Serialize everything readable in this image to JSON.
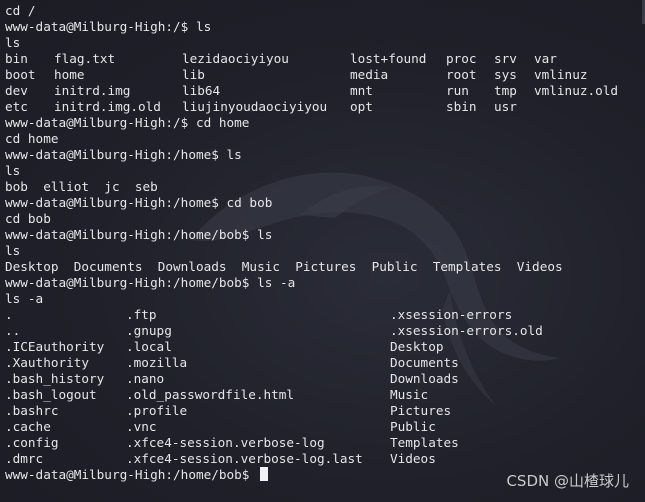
{
  "colors": {
    "background": "#1e1f29",
    "text": "#e6e6e6"
  },
  "lines": [
    "cd /",
    "www-data@Milburg-High:/$ ls",
    "ls"
  ],
  "root_listing": [
    [
      "bin",
      "flag.txt",
      "lezidaociyiyou",
      "lost+found",
      "proc",
      "srv",
      "var"
    ],
    [
      "boot",
      "home",
      "lib",
      "media",
      "root",
      "sys",
      "vmlinuz"
    ],
    [
      "dev",
      "initrd.img",
      "lib64",
      "mnt",
      "run",
      "tmp",
      "vmlinuz.old"
    ],
    [
      "etc",
      "initrd.img.old",
      "liujinyoudaociyiyou",
      "opt",
      "sbin",
      "usr",
      ""
    ]
  ],
  "lines2": [
    "www-data@Milburg-High:/$ cd home",
    "cd home",
    "www-data@Milburg-High:/home$ ls",
    "ls",
    "bob  elliot  jc  seb",
    "www-data@Milburg-High:/home$ cd bob",
    "cd bob",
    "www-data@Milburg-High:/home/bob$ ls",
    "ls",
    "Desktop  Documents  Downloads  Music  Pictures  Public  Templates  Videos",
    "www-data@Milburg-High:/home/bob$ ls -a",
    "ls -a"
  ],
  "bob_listing": [
    [
      ".",
      ".ftp",
      ".xsession-errors"
    ],
    [
      "..",
      ".gnupg",
      ".xsession-errors.old"
    ],
    [
      ".ICEauthority",
      ".local",
      "Desktop"
    ],
    [
      ".Xauthority",
      ".mozilla",
      "Documents"
    ],
    [
      ".bash_history",
      ".nano",
      "Downloads"
    ],
    [
      ".bash_logout",
      ".old_passwordfile.html",
      "Music"
    ],
    [
      ".bashrc",
      ".profile",
      "Pictures"
    ],
    [
      ".cache",
      ".vnc",
      "Public"
    ],
    [
      ".config",
      ".xfce4-session.verbose-log",
      "Templates"
    ],
    [
      ".dmrc",
      ".xfce4-session.verbose-log.last",
      "Videos"
    ]
  ],
  "prompt": "www-data@Milburg-High:/home/bob$ ",
  "watermark": "CSDN @山楂球儿",
  "icons": {
    "background_logo": "kali-dragon-icon"
  }
}
